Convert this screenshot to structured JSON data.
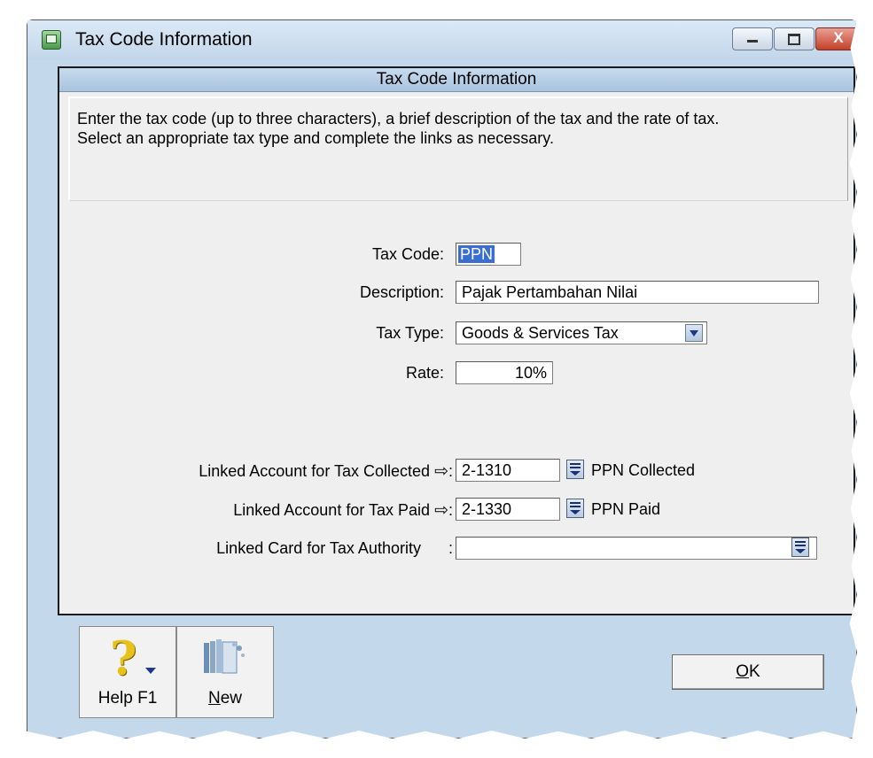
{
  "window": {
    "title": "Tax Code Information",
    "min_label": "",
    "max_label": "",
    "close_label": "X"
  },
  "header": {
    "title": "Tax Code Information"
  },
  "instructions": {
    "line1": "Enter the tax code (up to three characters), a brief description of the tax and the rate of tax.",
    "line2": "Select an appropriate tax type and complete the links as necessary."
  },
  "form": {
    "tax_code_label": "Tax Code:",
    "tax_code_value": "PPN",
    "description_label": "Description:",
    "description_value": "Pajak Pertambahan Nilai",
    "tax_type_label": "Tax Type:",
    "tax_type_value": "Goods & Services Tax",
    "rate_label": "Rate:",
    "rate_value": "10%"
  },
  "links": {
    "collected_label": "Linked Account for Tax Collected",
    "collected_account": "2-1310",
    "collected_name": "PPN Collected",
    "paid_label": "Linked Account for Tax Paid",
    "paid_account": "2-1330",
    "paid_name": "PPN Paid",
    "authority_label": "Linked Card for Tax Authority",
    "authority_value": "",
    "arrow_suffix": ":",
    "plain_suffix": ":",
    "arrow_icon": "arrow-right-icon"
  },
  "toolbar": {
    "help_label": "Help F1",
    "new_label_rest": "ew",
    "new_label_accel": "N",
    "ok_label_accel": "O",
    "ok_label_rest": "K"
  },
  "colors": {
    "header_bar": "#b8cfe7",
    "selection": "#3a6fd1",
    "close_button": "#c4402a"
  }
}
